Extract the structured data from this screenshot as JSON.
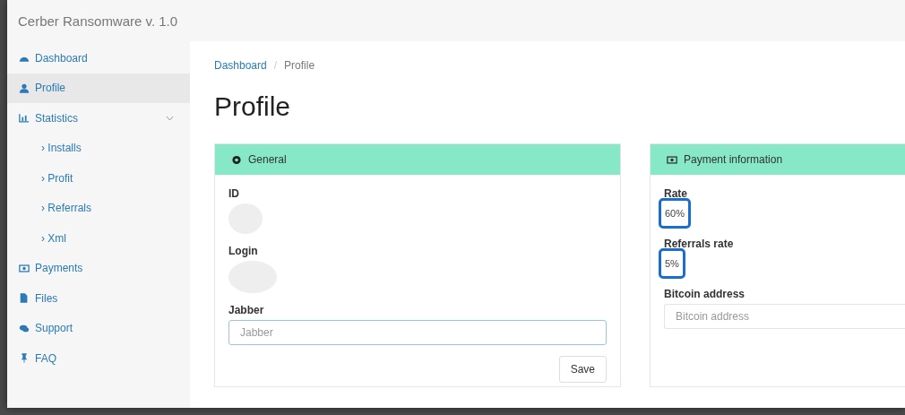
{
  "app_title": "Cerber Ransomware v. 1.0",
  "sidebar": {
    "items": [
      {
        "label": "Dashboard",
        "selected": false
      },
      {
        "label": "Profile",
        "selected": true
      },
      {
        "label": "Statistics",
        "selected": false,
        "expanded": true,
        "children": [
          {
            "marker": "›",
            "label": "Installs",
            "selected": false
          },
          {
            "marker": "›",
            "label": "Profit",
            "selected": false
          },
          {
            "marker": "›",
            "label": "Referrals",
            "selected": false
          },
          {
            "marker": "›",
            "label": "Xml",
            "selected": false
          }
        ]
      },
      {
        "label": "Payments",
        "selected": false
      },
      {
        "label": "Files",
        "selected": false
      },
      {
        "label": "Support",
        "selected": false
      },
      {
        "label": "FAQ",
        "selected": false
      }
    ]
  },
  "breadcrumb": [
    {
      "label": "Dashboard",
      "kind": "link"
    },
    {
      "label": "/",
      "kind": "separator"
    },
    {
      "label": "Profile",
      "kind": "current"
    }
  ],
  "page_title": "Profile",
  "general": {
    "title": "General",
    "fields": [
      {
        "kind": "redacted",
        "label": "ID"
      },
      {
        "kind": "redacted",
        "label": "Login"
      },
      {
        "kind": "input",
        "label": "Jabber",
        "placeholder": "Jabber"
      }
    ],
    "button": "Save"
  },
  "payment": {
    "title": "Payment information",
    "fields": [
      {
        "kind": "text",
        "label": "Rate",
        "value": "60%",
        "highlighted": true
      },
      {
        "kind": "text",
        "label": "Referrals rate",
        "value": "5%",
        "highlighted": true
      },
      {
        "kind": "input",
        "label": "Bitcoin address",
        "placeholder": "Bitcoin address"
      }
    ]
  }
}
